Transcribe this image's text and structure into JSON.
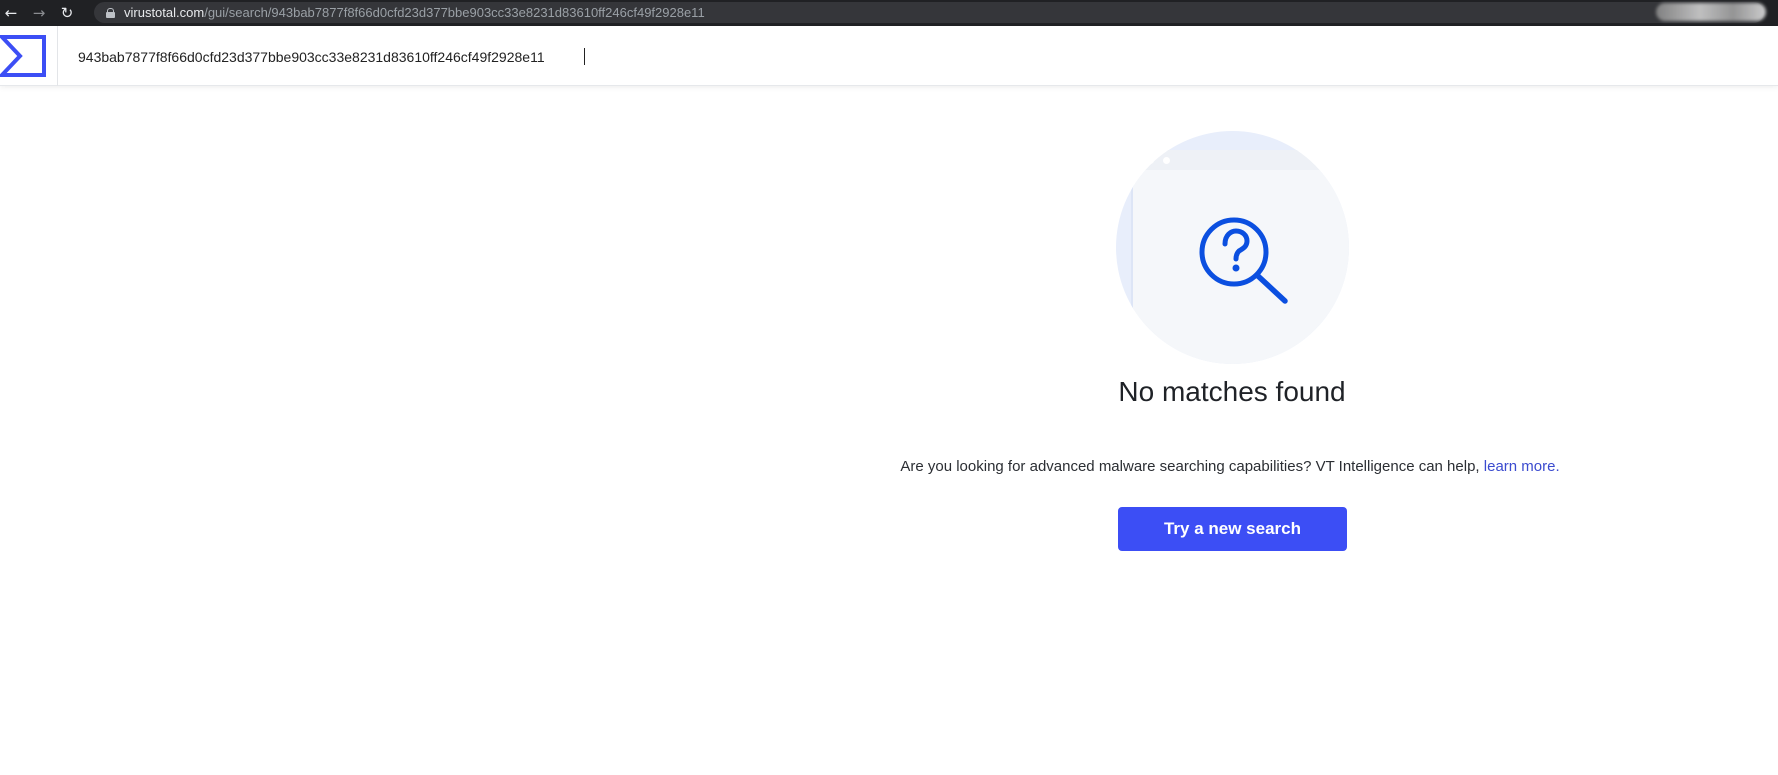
{
  "browser": {
    "url_host": "virustotal.com",
    "url_path": "/gui/search/943bab7877f8f66d0cfd23d377bbe903cc33e8231d83610ff246cf49f2928e11"
  },
  "header": {
    "search_value": "943bab7877f8f66d0cfd23d377bbe903cc33e8231d83610ff246cf49f2928e11",
    "logo_icon": "virustotal-sigma-logo"
  },
  "empty_state": {
    "illustration_icon": "question-magnifier-icon",
    "title": "No matches found",
    "description": "Are you looking for advanced malware searching capabilities? VT Intelligence can help, ",
    "link_text": "learn more.",
    "button_label": "Try a new search"
  },
  "colors": {
    "brand_blue": "#3c4ef5",
    "icon_blue": "#0b4fe0",
    "link": "#3b4bcf"
  }
}
